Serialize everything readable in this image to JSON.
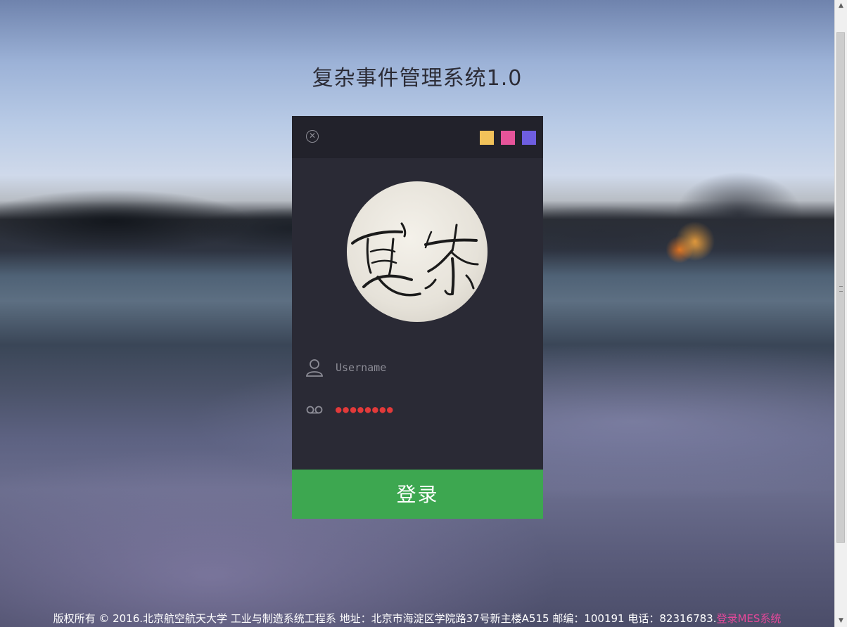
{
  "page": {
    "title": "复杂事件管理系统1.0"
  },
  "panel": {
    "close_icon": "close-icon",
    "theme_swatches": [
      {
        "name": "yellow",
        "color": "#f1c25a"
      },
      {
        "name": "pink",
        "color": "#e6549a"
      },
      {
        "name": "purple",
        "color": "#6e5ee0"
      }
    ],
    "avatar_icon": "calligraphy-avatar",
    "username": {
      "icon": "user-icon",
      "placeholder": "Username",
      "value": ""
    },
    "password": {
      "icon": "voicemail-icon",
      "placeholder": "",
      "value": "●●●●●●●●"
    },
    "login_label": "登录",
    "login_color": "#3da750"
  },
  "footer": {
    "text": "版权所有 © 2016.北京航空航天大学 工业与制造系统工程系 地址：北京市海淀区学院路37号新主楼A515 邮编：100191 电话：82316783.",
    "link_label": "登录MES系统",
    "link_color": "#e5489a"
  }
}
